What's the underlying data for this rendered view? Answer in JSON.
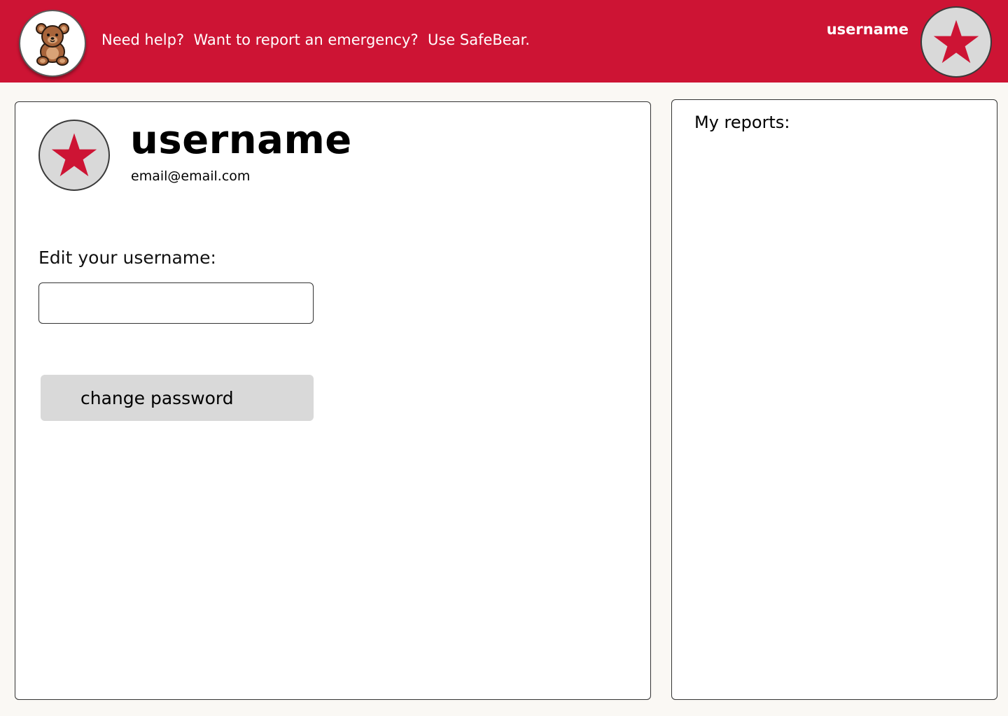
{
  "header": {
    "logo_icon": "teddy-bear-icon",
    "tagline": "Need help?  Want to report an emergency?  Use SafeBear.",
    "username": "username",
    "avatar_icon": "star-icon",
    "accent_color": "#cd1434"
  },
  "profile": {
    "username": "username",
    "email": "email@email.com",
    "avatar_icon": "star-icon",
    "edit_label": "Edit your username:",
    "username_input_value": "",
    "change_password_label": "change password"
  },
  "reports": {
    "title": "My reports:"
  }
}
